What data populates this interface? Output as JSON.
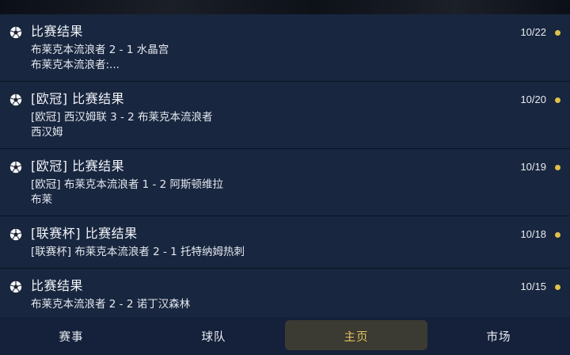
{
  "notices": [
    {
      "title": "比赛结果",
      "date": "10/22",
      "lines": [
        "布莱克本流浪者 2 - 1 水晶宫",
        "布莱克本流浪者:..."
      ]
    },
    {
      "title": "[欧冠] 比赛结果",
      "date": "10/20",
      "lines": [
        "[欧冠] 西汉姆联 3 - 2 布莱克本流浪者",
        "西汉姆"
      ]
    },
    {
      "title": "[欧冠] 比赛结果",
      "date": "10/19",
      "lines": [
        "[欧冠] 布莱克本流浪者 1 - 2 阿斯顿维拉",
        "布莱"
      ]
    },
    {
      "title": "[联赛杯] 比赛结果",
      "date": "10/18",
      "lines": [
        "[联赛杯] 布莱克本流浪者 2 - 1 托特纳姆热刺"
      ]
    },
    {
      "title": "比赛结果",
      "date": "10/15",
      "lines": [
        "布莱克本流浪者 2 - 2 诺丁汉森林"
      ]
    }
  ],
  "icons": {
    "notice": "soccer-ball-icon"
  },
  "colors": {
    "background": "#16223a",
    "unread_dot": "#e2c04a",
    "active_tab": "#e0c35a",
    "active_tab_bg": "#3b3a33"
  },
  "tabs": [
    {
      "label": "赛事",
      "active": false
    },
    {
      "label": "球队",
      "active": false
    },
    {
      "label": "主页",
      "active": true
    },
    {
      "label": "市场",
      "active": false
    }
  ]
}
